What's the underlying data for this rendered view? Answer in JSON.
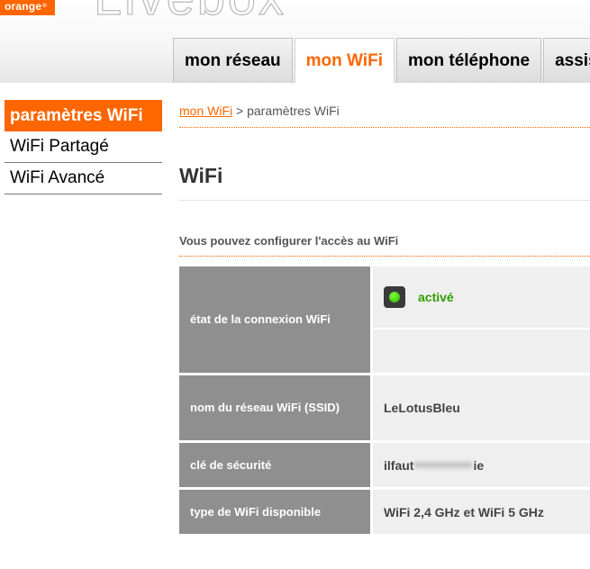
{
  "header": {
    "brand": "orange",
    "brand_mark": "®",
    "product": "Livebox",
    "tabs": [
      "mon réseau",
      "mon WiFi",
      "mon téléphone",
      "assist"
    ],
    "active_tab": "mon WiFi"
  },
  "sidebar": {
    "items": [
      "paramètres WiFi",
      "WiFi Partagé",
      "WiFi Avancé"
    ],
    "active_item": "paramètres WiFi"
  },
  "breadcrumb": {
    "link": "mon WiFi",
    "separator": " > ",
    "current": "paramètres WiFi"
  },
  "page": {
    "title": "WiFi",
    "intro": "Vous pouvez configurer l'accès au WiFi"
  },
  "wifi_table": {
    "rows": [
      {
        "label": "état de la connexion WiFi",
        "value": "activé"
      },
      {
        "label": "nom du réseau WiFi (SSID)",
        "value": "LeLotusBleu"
      },
      {
        "label": "clé de sécurité",
        "value_start": "ilfaut",
        "value_end": "ie"
      },
      {
        "label": "type de WiFi disponible",
        "value": "WiFi 2,4 GHz et WiFi 5 GHz"
      }
    ]
  },
  "colors": {
    "accent": "#ff6600",
    "status_active": "#2f9d00",
    "label_bg": "#8f8f8f",
    "value_bg": "#efefef"
  },
  "icons": {
    "status": "green-status-light-icon"
  }
}
